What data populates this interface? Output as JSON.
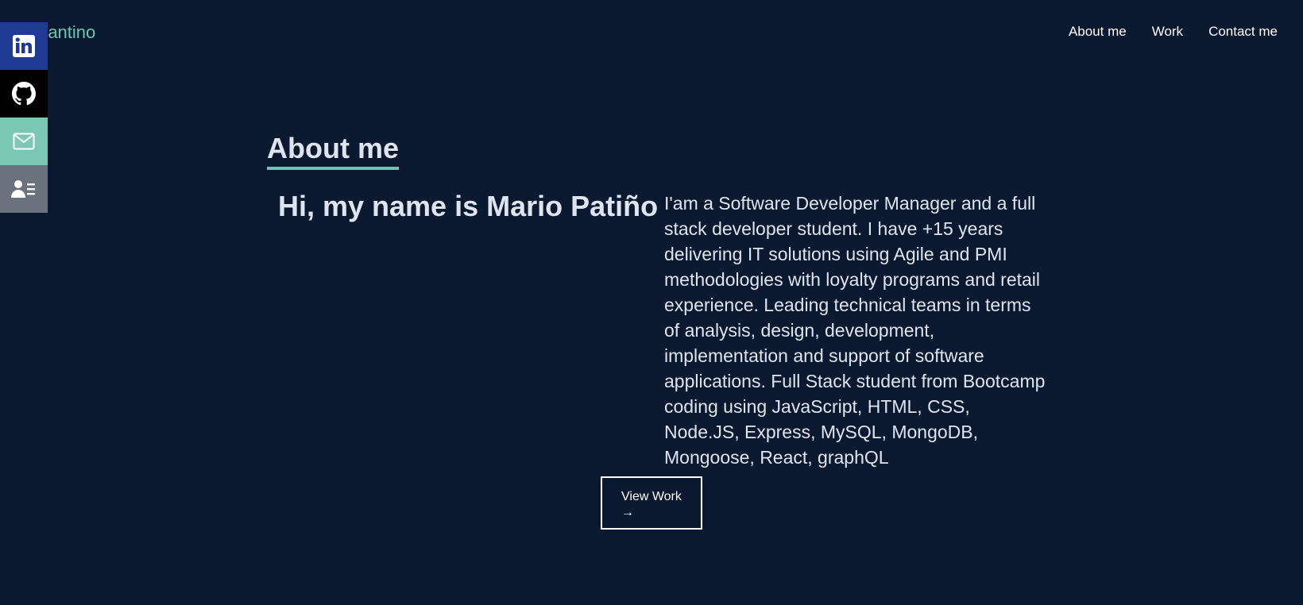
{
  "header": {
    "brand": "mantino",
    "nav": [
      {
        "label": "About me"
      },
      {
        "label": "Work"
      },
      {
        "label": "Contact me"
      }
    ]
  },
  "social": [
    {
      "icon": "linkedin-icon",
      "color": "#1f3a93"
    },
    {
      "icon": "github-icon",
      "color": "#000000"
    },
    {
      "icon": "email-icon",
      "color": "#7bc8b4"
    },
    {
      "icon": "resume-icon",
      "color": "#6a727d"
    }
  ],
  "about": {
    "title": "About me",
    "greeting": "Hi, my name is Mario Patiño",
    "bio": "I'am a Software Developer Manager and a full stack developer student. I have +15 years delivering IT solutions using Agile and PMI methodologies with loyalty programs and retail experience. Leading technical teams in terms of analysis, design, development, implementation and support of software applications. Full Stack student from Bootcamp coding using JavaScript, HTML, CSS, Node.JS, Express, MySQL, MongoDB, Mongoose, React, graphQL",
    "button_label": "View Work",
    "button_arrow": "→"
  },
  "colors": {
    "background": "#0a192f",
    "accent": "#64c9b0",
    "text": "#dfe5ef"
  }
}
